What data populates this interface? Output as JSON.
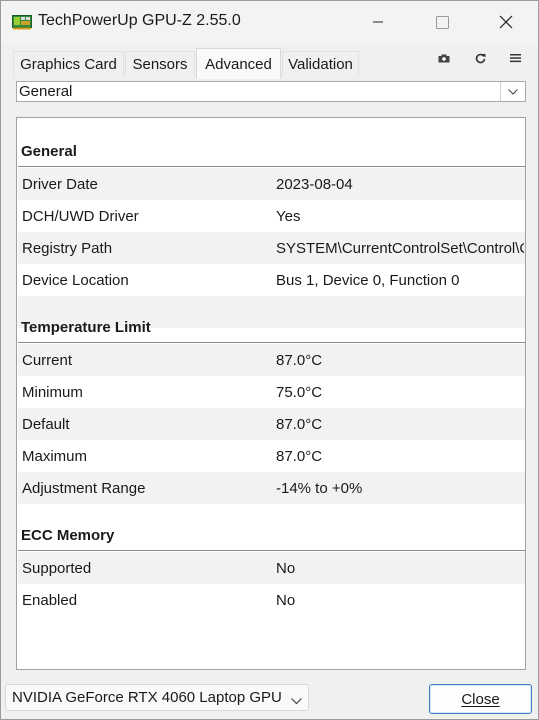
{
  "window": {
    "title": "TechPowerUp GPU-Z 2.55.0"
  },
  "tabs": [
    {
      "label": "Graphics Card",
      "active": false
    },
    {
      "label": "Sensors",
      "active": false
    },
    {
      "label": "Advanced",
      "active": true
    },
    {
      "label": "Validation",
      "active": false
    }
  ],
  "toolbar_icons": [
    "camera-icon",
    "refresh-icon",
    "menu-icon"
  ],
  "category_dropdown": {
    "selected": "General"
  },
  "sections": [
    {
      "title": "General",
      "rows": [
        {
          "key": "Driver Date",
          "value": "2023-08-04"
        },
        {
          "key": "DCH/UWD Driver",
          "value": "Yes"
        },
        {
          "key": "Registry Path",
          "value": "SYSTEM\\CurrentControlSet\\Control\\Cl"
        },
        {
          "key": "Device Location",
          "value": "Bus 1, Device 0, Function 0"
        }
      ]
    },
    {
      "title": "Temperature Limit",
      "rows": [
        {
          "key": "Current",
          "value": "87.0°C"
        },
        {
          "key": "Minimum",
          "value": "75.0°C"
        },
        {
          "key": "Default",
          "value": "87.0°C"
        },
        {
          "key": "Maximum",
          "value": "87.0°C"
        },
        {
          "key": "Adjustment Range",
          "value": "-14% to +0%"
        }
      ]
    },
    {
      "title": "ECC Memory",
      "rows": [
        {
          "key": "Supported",
          "value": "No"
        },
        {
          "key": "Enabled",
          "value": "No"
        }
      ]
    }
  ],
  "footer": {
    "gpu_selected": "NVIDIA GeForce RTX 4060 Laptop GPU",
    "close_label": "Close"
  }
}
